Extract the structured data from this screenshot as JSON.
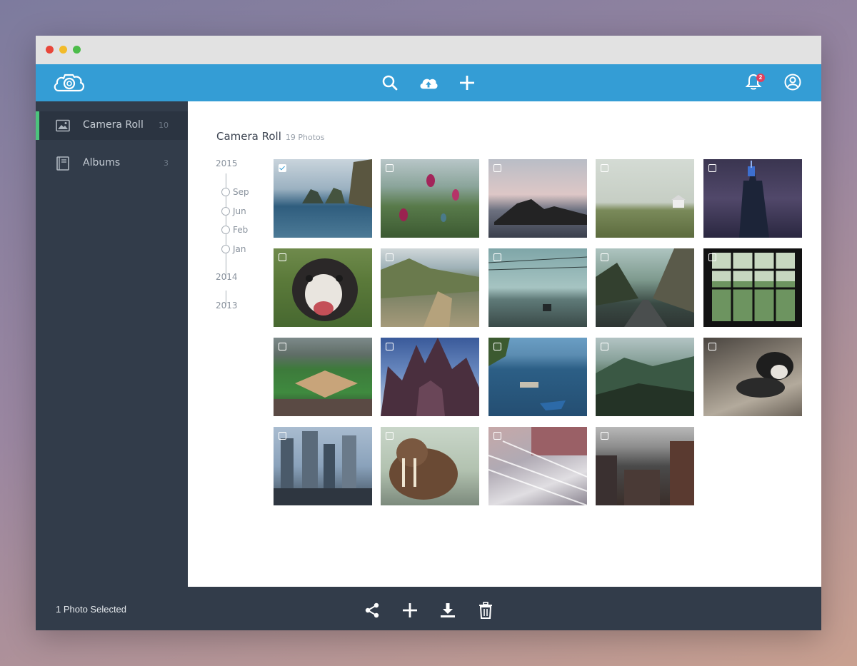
{
  "window_controls": [
    "close",
    "minimize",
    "maximize"
  ],
  "colors": {
    "accent": "#349dd5",
    "sidebar": "#323c4a",
    "active_indicator": "#4cc37d",
    "badge": "#e2405e"
  },
  "header": {
    "logo_icon": "camera-cloud-icon",
    "tools": [
      "search-icon",
      "cloud-upload-icon",
      "plus-icon"
    ],
    "notifications": {
      "icon": "bell-icon",
      "count": "2"
    },
    "profile_icon": "user-circle-icon"
  },
  "sidebar": {
    "items": [
      {
        "icon": "image-icon",
        "label": "Camera Roll",
        "count": "10",
        "active": true
      },
      {
        "icon": "album-book-icon",
        "label": "Albums",
        "count": "3",
        "active": false
      }
    ]
  },
  "main": {
    "title": "Camera Roll",
    "subtitle": "19 Photos"
  },
  "timeline": {
    "years": [
      "2015",
      "2014",
      "2013"
    ],
    "months_2015": [
      "Sep",
      "Jun",
      "Feb",
      "Jan"
    ]
  },
  "photos": [
    {
      "selected": true
    },
    {
      "selected": false
    },
    {
      "selected": false
    },
    {
      "selected": false
    },
    {
      "selected": false
    },
    {
      "selected": false
    },
    {
      "selected": false
    },
    {
      "selected": false
    },
    {
      "selected": false
    },
    {
      "selected": false
    },
    {
      "selected": false
    },
    {
      "selected": false
    },
    {
      "selected": false
    },
    {
      "selected": false
    },
    {
      "selected": false
    },
    {
      "selected": false
    },
    {
      "selected": false
    },
    {
      "selected": false
    },
    {
      "selected": false
    }
  ],
  "footer": {
    "selection_text": "1 Photo Selected",
    "actions": [
      "share-icon",
      "plus-icon",
      "download-icon",
      "trash-icon"
    ]
  }
}
